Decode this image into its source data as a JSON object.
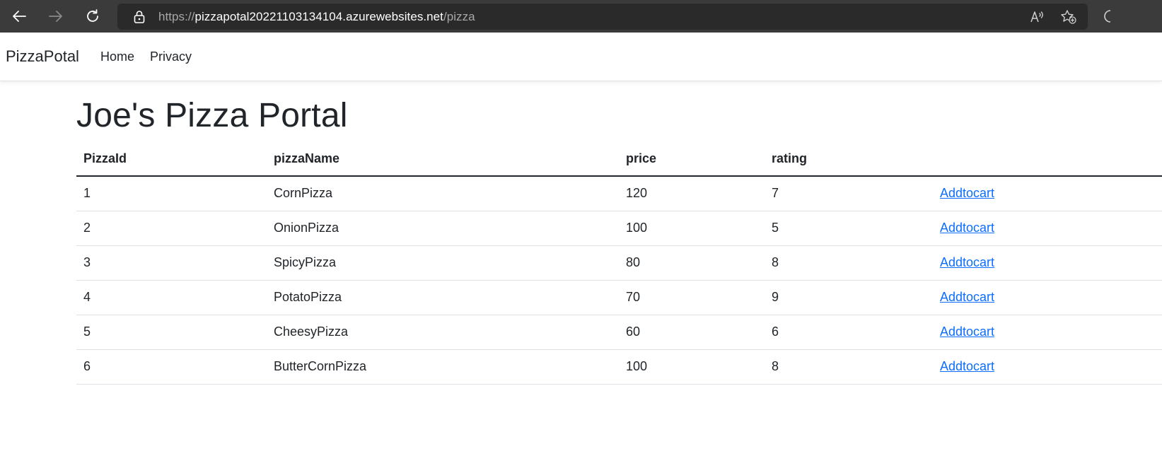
{
  "browser": {
    "url_scheme": "https://",
    "url_host": "pizzapotal20221103134104.azurewebsites.net",
    "url_path": "/pizza"
  },
  "navbar": {
    "brand": "PizzaPotal",
    "links": [
      "Home",
      "Privacy"
    ]
  },
  "main": {
    "title": "Joe's Pizza Portal",
    "table": {
      "headers": [
        "PizzaId",
        "pizzaName",
        "price",
        "rating",
        ""
      ],
      "action_label": "Addtocart",
      "rows": [
        {
          "id": "1",
          "name": "CornPizza",
          "price": "120",
          "rating": "7"
        },
        {
          "id": "2",
          "name": "OnionPizza",
          "price": "100",
          "rating": "5"
        },
        {
          "id": "3",
          "name": "SpicyPizza",
          "price": "80",
          "rating": "8"
        },
        {
          "id": "4",
          "name": "PotatoPizza",
          "price": "70",
          "rating": "9"
        },
        {
          "id": "5",
          "name": "CheesyPizza",
          "price": "60",
          "rating": "6"
        },
        {
          "id": "6",
          "name": "ButterCornPizza",
          "price": "100",
          "rating": "8"
        }
      ]
    }
  },
  "colors": {
    "browser_chrome": "#3b3b3b",
    "address_bar": "#2a2a2a",
    "link": "#0d6efd",
    "text": "#212529"
  },
  "icons": [
    "back-arrow-icon",
    "forward-arrow-icon",
    "refresh-icon",
    "lock-icon",
    "read-aloud-icon",
    "add-favorite-icon",
    "extensions-icon"
  ]
}
